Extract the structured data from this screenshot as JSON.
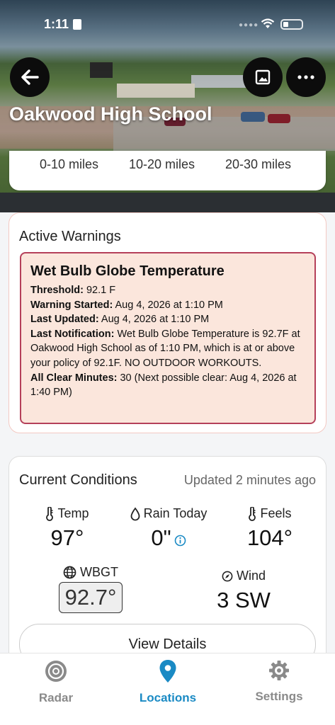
{
  "status_bar": {
    "time": "1:11"
  },
  "header": {
    "school_name": "Oakwood High School"
  },
  "distance_tabs": [
    "0-10 miles",
    "10-20 miles",
    "20-30 miles"
  ],
  "warnings": {
    "section_title": "Active Warnings",
    "title": "Wet Bulb Globe Temperature",
    "threshold_label": "Threshold:",
    "threshold_value": " 92.1 F",
    "started_label": "Warning Started:",
    "started_value": " Aug 4, 2026 at 1:10 PM",
    "updated_label": "Last Updated:",
    "updated_value": " Aug 4, 2026 at 1:10 PM",
    "notification_label": "Last Notification:",
    "notification_value": " Wet Bulb Globe Temperature is 92.7F at Oakwood High School  as of 1:10 PM, which is at or above your policy of 92.1F. NO OUTDOOR WORKOUTS.",
    "allclear_label": "All Clear Minutes:",
    "allclear_value": " 30 (Next possible clear: Aug 4, 2026 at 1:40 PM)",
    "accent_color": "#b5405a"
  },
  "conditions": {
    "title": "Current Conditions",
    "updated": "Updated 2 minutes ago",
    "temp_label": "Temp",
    "temp_value": "97°",
    "rain_label": "Rain Today",
    "rain_value": "0\"",
    "feels_label": "Feels",
    "feels_value": "104°",
    "wbgt_label": "WBGT",
    "wbgt_value": "92.7°",
    "wind_label": "Wind",
    "wind_value": "3 SW",
    "details_button": "View Details"
  },
  "nav": {
    "items": [
      {
        "label": "Radar",
        "icon": "radar-icon",
        "active": false
      },
      {
        "label": "Locations",
        "icon": "location-pin-icon",
        "active": true
      },
      {
        "label": "Settings",
        "icon": "gear-icon",
        "active": false
      }
    ],
    "active_color": "#1a8ac4"
  }
}
